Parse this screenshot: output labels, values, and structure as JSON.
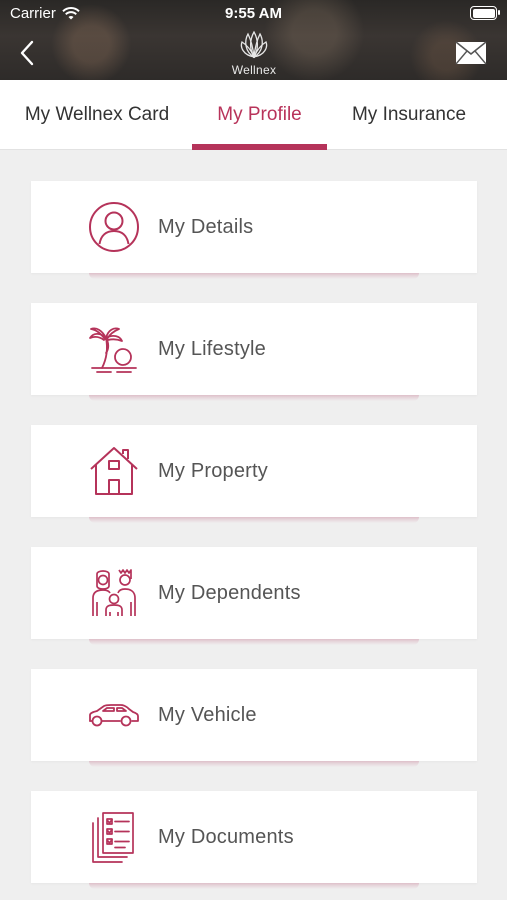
{
  "status_bar": {
    "carrier": "Carrier",
    "time": "9:55 AM"
  },
  "header": {
    "logo_text": "Wellnex",
    "back_icon": "chevron-left-icon",
    "mail_icon": "envelope-icon"
  },
  "tabs": [
    {
      "label": "My Wellnex Card"
    },
    {
      "label": "My Profile",
      "active": true
    },
    {
      "label": "My Insurance"
    }
  ],
  "menu": [
    {
      "label": "My Details",
      "icon": "person-icon"
    },
    {
      "label": "My Lifestyle",
      "icon": "palm-tree-sunset-icon"
    },
    {
      "label": "My Property",
      "icon": "house-icon"
    },
    {
      "label": "My Dependents",
      "icon": "family-icon"
    },
    {
      "label": "My Vehicle",
      "icon": "car-icon"
    },
    {
      "label": "My Documents",
      "icon": "documents-checklist-icon"
    }
  ],
  "colors": {
    "accent": "#b5335a",
    "header_bg": "#2e2b29",
    "background": "#efefef",
    "card": "#ffffff"
  }
}
